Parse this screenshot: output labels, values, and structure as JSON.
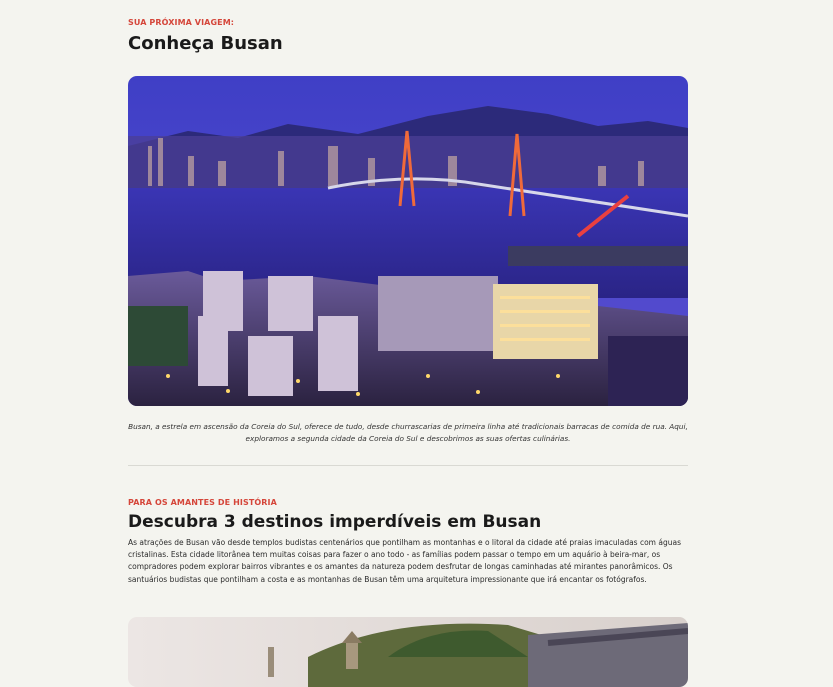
{
  "intro": {
    "eyebrow": "SUA PRÓXIMA VIAGEM:",
    "title": "Conheça Busan"
  },
  "hero_image": {
    "caption_line1": "Busan, a estrela em ascensão da Coreia do Sul, oferece de tudo, desde churrascarias de primeira linha até tradicionais barracas de comida de rua. Aqui,",
    "caption_line2": "exploramos a segunda cidade da Coreia do Sul e descobrimos as suas ofertas culinárias."
  },
  "history": {
    "eyebrow": "PARA OS AMANTES DE HISTÓRIA",
    "title": "Descubra 3 destinos imperdíveis em Busan",
    "line1": "As atrações de Busan vão desde templos budistas centenários que pontilham as montanhas e o litoral da cidade até praias imaculadas com águas",
    "line2": "cristalinas. Esta cidade litorânea tem muitas coisas para fazer o ano todo - as famílias podem passar o tempo em um aquário à beira-mar, os",
    "line3": "compradores podem explorar bairros vibrantes e os amantes da natureza podem desfrutar de longas caminhadas até mirantes panorâmicos. Os",
    "line4": "santuários budistas que pontilham a costa e as montanhas de Busan têm uma arquitetura impressionante que irá encantar os fotógrafos."
  },
  "colors": {
    "accent": "#d5463a",
    "background": "#f4f4ef"
  }
}
